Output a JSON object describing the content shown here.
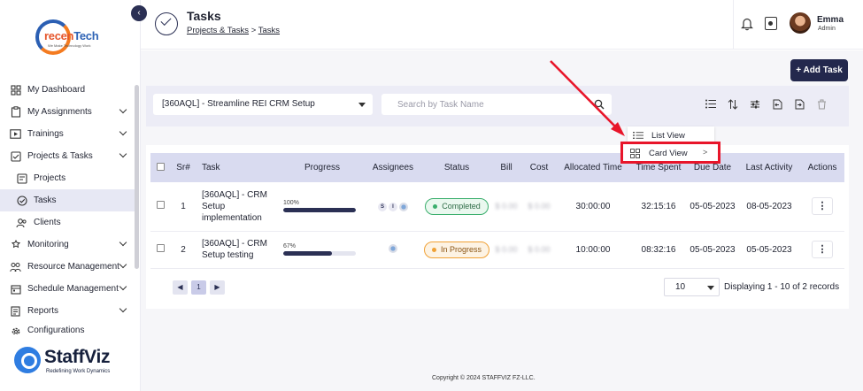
{
  "logo": {
    "text_orange": "recen",
    "text_blue": "Tech",
    "tagline": "We Make Technology Work"
  },
  "sidebar": {
    "items": [
      {
        "label": "My Dashboard",
        "icon": "dashboard-icon",
        "chevron": false
      },
      {
        "label": "My Assignments",
        "icon": "clipboard-icon",
        "chevron": true
      },
      {
        "label": "Trainings",
        "icon": "video-icon",
        "chevron": true
      },
      {
        "label": "Projects & Tasks",
        "icon": "folder-icon",
        "chevron": true
      },
      {
        "label": "Projects",
        "icon": "folder-icon",
        "sub": true
      },
      {
        "label": "Tasks",
        "icon": "check-circle-icon",
        "sub": true,
        "active": true
      },
      {
        "label": "Clients",
        "icon": "users-icon",
        "sub": true
      },
      {
        "label": "Monitoring",
        "icon": "monitor-icon",
        "chevron": true
      },
      {
        "label": "Resource Management",
        "icon": "people-icon",
        "chevron": true
      },
      {
        "label": "Schedule Management",
        "icon": "calendar-icon",
        "chevron": true
      },
      {
        "label": "Reports",
        "icon": "report-icon",
        "chevron": true
      },
      {
        "label": "Configurations",
        "icon": "gear-icon",
        "chevron": true
      }
    ]
  },
  "brand": {
    "name": "StaffViz",
    "tagline": "Redefining Work Dynamics"
  },
  "header": {
    "title": "Tasks",
    "breadcrumb_parent": "Projects & Tasks",
    "breadcrumb_sep": ">",
    "breadcrumb_current": "Tasks",
    "user_name": "Emma",
    "user_role": "Admin"
  },
  "toolbar": {
    "add_task_label": "+ Add Task",
    "project_selected": "[360AQL] - Streamline REI CRM Setup",
    "search_placeholder": "Search by Task Name"
  },
  "menu": {
    "list_view": "List View",
    "card_view": "Card View",
    "card_view_arrow": ">"
  },
  "table": {
    "headers": [
      "",
      "Sr#",
      "Task",
      "Progress",
      "Assignees",
      "Status",
      "Bill",
      "Cost",
      "Allocated Time",
      "Time Spent",
      "Due Date",
      "Last Activity",
      "Actions"
    ],
    "rows": [
      {
        "sr": "1",
        "task": "[360AQL] - CRM Setup implementation",
        "progress_label": "100%",
        "progress": 1.0,
        "assignee_initials": [
          "S",
          "I"
        ],
        "status": "Completed",
        "bill": "$ 0.00",
        "cost": "$ 0.00",
        "allocated": "30:00:00",
        "spent": "32:15:16",
        "due": "05-05-2023",
        "last_activity": "08-05-2023",
        "actions": "⋮"
      },
      {
        "sr": "2",
        "task": "[360AQL] - CRM Setup testing",
        "progress_label": "67%",
        "progress": 0.67,
        "assignee_initials": [],
        "status": "In Progress",
        "bill": "$ 0.00",
        "cost": "$ 0.00",
        "allocated": "10:00:00",
        "spent": "08:32:16",
        "due": "05-05-2023",
        "last_activity": "05-05-2023",
        "actions": "⋮"
      }
    ]
  },
  "pagination": {
    "prev": "◀",
    "current_page": "1",
    "next": "▶",
    "page_size": "10",
    "displaying": "Displaying 1 - 10 of 2 records"
  },
  "footer": {
    "copyright": "Copyright © 2024 STAFFVIZ FZ-LLC."
  },
  "colors": {
    "primary": "#23284d",
    "header_row": "#d9dbf0",
    "completed": "#3aae6c",
    "in_progress": "#f0a135",
    "annotation": "#e8152a"
  }
}
